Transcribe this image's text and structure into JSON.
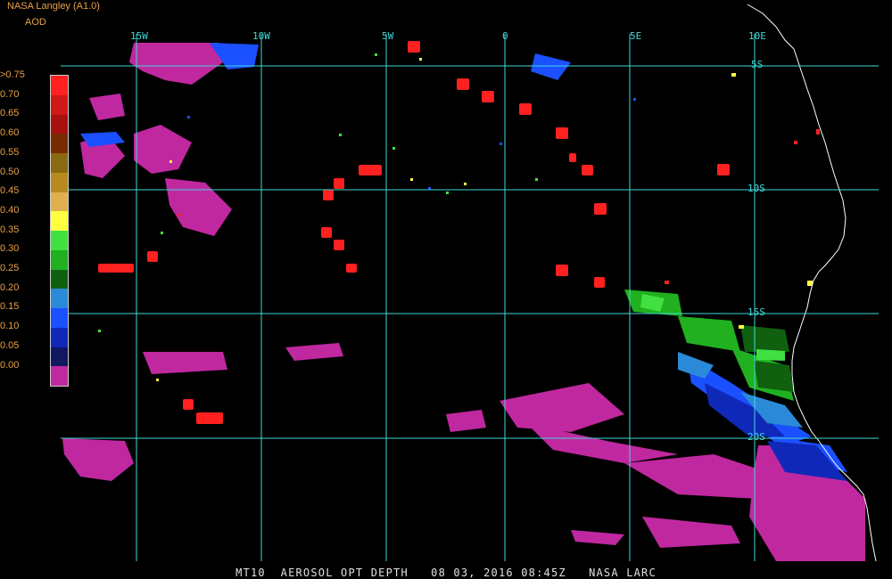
{
  "credit": {
    "line1": "NASA Langley (A1.0)",
    "line2": "AOD",
    "color": "#e8a047"
  },
  "title": "MT10  AEROSOL OPT DEPTH   08 03, 2016 08:45Z   NASA LARC",
  "colors": {
    "grid": "#40d8d8",
    "coast": "#ffffff",
    "label": "#e8a047",
    "title": "#e0e0e0"
  },
  "colorbar": {
    "labels": [
      ">0.75",
      "0.70",
      "0.65",
      "0.60",
      "0.55",
      "0.50",
      "0.45",
      "0.40",
      "0.35",
      "0.30",
      "0.25",
      "0.20",
      "0.15",
      "0.10",
      "0.05",
      "0.00"
    ],
    "colors": [
      "#ff2020",
      "#d01818",
      "#a81010",
      "#7a2a00",
      "#8a6a10",
      "#b88a20",
      "#e0b050",
      "#ffff40",
      "#40e040",
      "#20b020",
      "#106010",
      "#2a8ad8",
      "#1a50ff",
      "#1028b8",
      "#101860",
      "#c028a0"
    ]
  },
  "grid": {
    "lon_labels": [
      "15W",
      "10W",
      "5W",
      "0",
      "5E",
      "10E"
    ],
    "lat_labels": [
      "5S",
      "10S",
      "15S",
      "20S"
    ]
  }
}
